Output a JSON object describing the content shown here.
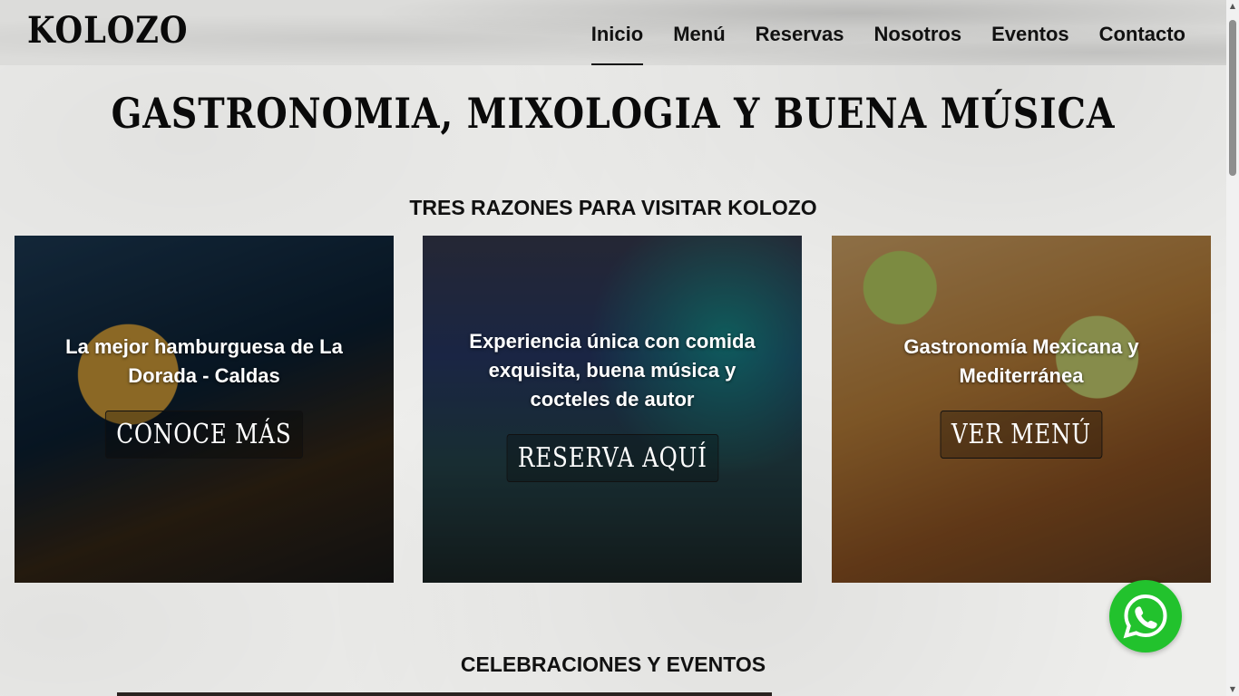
{
  "header": {
    "logo": "KOLOZO",
    "nav": [
      {
        "label": "Inicio",
        "active": true
      },
      {
        "label": "Menú",
        "active": false
      },
      {
        "label": "Reservas",
        "active": false
      },
      {
        "label": "Nosotros",
        "active": false
      },
      {
        "label": "Eventos",
        "active": false
      },
      {
        "label": "Contacto",
        "active": false
      }
    ]
  },
  "hero": {
    "title": "GASTRONOMIA, MIXOLOGIA Y BUENA MÚSICA"
  },
  "reasons": {
    "title": "TRES RAZONES PARA VISITAR KOLOZO",
    "cards": [
      {
        "text": "La mejor hamburguesa de La Dorada - Caldas",
        "button": "CONOCE MÁS"
      },
      {
        "text": "Experiencia única con comida exquisita, buena música y cocteles de autor",
        "button": "RESERVA AQUÍ"
      },
      {
        "text": "Gastronomía Mexicana y Mediterránea",
        "button": "VER MENÚ"
      }
    ]
  },
  "events": {
    "title": "CELEBRACIONES Y EVENTOS"
  },
  "icons": {
    "whatsapp": "whatsapp-icon",
    "whatsapp_color": "#22c22d"
  }
}
